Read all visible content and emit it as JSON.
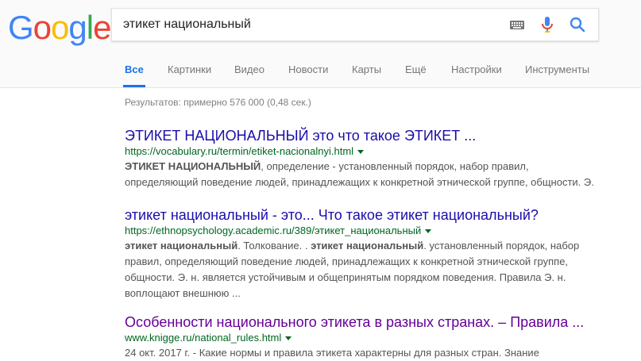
{
  "logo": {
    "letters": [
      "G",
      "o",
      "o",
      "g",
      "l",
      "e"
    ],
    "colors": [
      "#4285F4",
      "#EA4335",
      "#FBBC05",
      "#4285F4",
      "#34A853",
      "#EA4335"
    ]
  },
  "search": {
    "query": "этикет национальный",
    "icons": [
      "keyboard-icon",
      "microphone-icon",
      "search-icon"
    ]
  },
  "tabs": [
    "Все",
    "Картинки",
    "Видео",
    "Новости",
    "Карты",
    "Ещё",
    "Настройки",
    "Инструменты"
  ],
  "stats": "Результатов: примерно 576 000 (0,48 сек.)",
  "results": [
    {
      "title": "ЭТИКЕТ НАЦИОНАЛЬНЫЙ это что такое ЭТИКЕТ ...",
      "url": "https://vocabulary.ru/termin/etiket-nacionalnyi.html",
      "snippet_lines": [
        [
          {
            "b": "ЭТИКЕТ НАЦИОНАЛЬНЫЙ"
          },
          {
            "t": ", определение - установленный порядок, набор правил,"
          }
        ],
        [
          {
            "t": "определяющий поведение людей, принадлежащих к конкретной этнической группе, общности. Э."
          }
        ]
      ]
    },
    {
      "title": "этикет национальный - это... Что такое этикет национальный?",
      "url": "https://ethnopsychology.academic.ru/389/этикет_национальный",
      "snippet_lines": [
        [
          {
            "b": "этикет национальный"
          },
          {
            "t": ". Толкование. . "
          },
          {
            "b": "этикет национальный"
          },
          {
            "t": ". установленный порядок, набор"
          }
        ],
        [
          {
            "t": "правил, определяющий поведение людей, принадлежащих к конкретной этнической группе,"
          }
        ],
        [
          {
            "t": "общности. Э. н. является устойчивым и общепринятым порядком поведения. Правила Э. н."
          }
        ],
        [
          {
            "t": "воплощают внешнюю ..."
          }
        ]
      ]
    },
    {
      "title": "Особенности национального этикета в разных странах. – Правила ...",
      "url": "www.knigge.ru/national_rules.html",
      "snippet_lines": [
        [
          {
            "t": "24 окт. 2017 г. - Какие нормы и правила этикета характерны для разных стран. Знание"
          }
        ]
      ]
    }
  ]
}
